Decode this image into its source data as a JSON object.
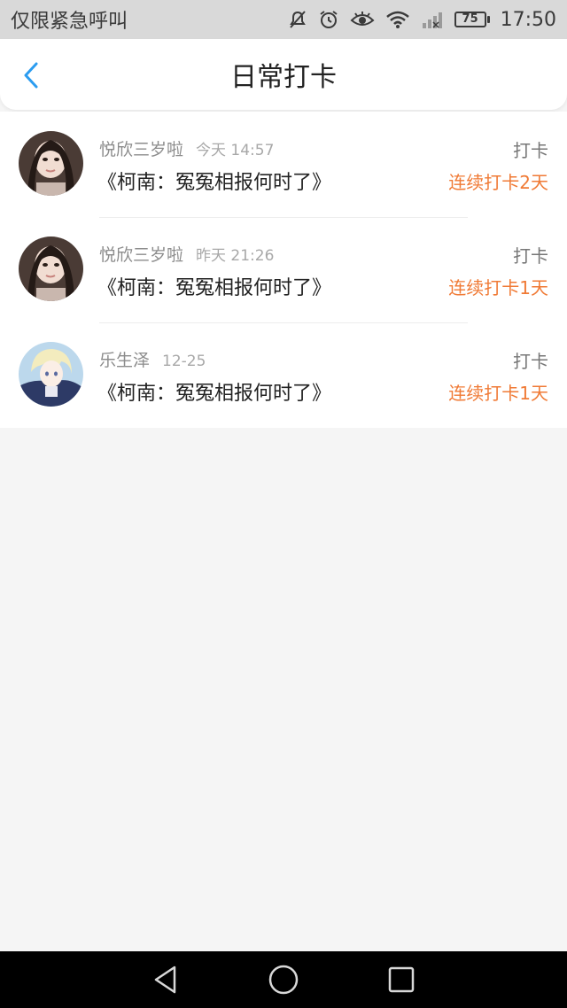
{
  "status_bar": {
    "carrier": "仅限紧急呼叫",
    "battery": "75",
    "time": "17:50",
    "icons": [
      "mute-icon",
      "alarm-icon",
      "eye-icon",
      "wifi-icon",
      "signal-icon"
    ]
  },
  "header": {
    "title": "日常打卡",
    "back_icon": "back-chevron-icon",
    "accent_color": "#2b9cf0"
  },
  "records": [
    {
      "name": "悦欣三岁啦",
      "time": "今天 14:57",
      "book": "《柯南：冤冤相报何时了》",
      "action": "打卡",
      "streak": "连续打卡2天"
    },
    {
      "name": "悦欣三岁啦",
      "time": "昨天 21:26",
      "book": "《柯南：冤冤相报何时了》",
      "action": "打卡",
      "streak": "连续打卡1天"
    },
    {
      "name": "乐生泽",
      "time": "12-25",
      "book": "《柯南：冤冤相报何时了》",
      "action": "打卡",
      "streak": "连续打卡1天"
    }
  ],
  "colors": {
    "streak": "#f07a35",
    "name": "#8c8c8c",
    "background": "#f5f5f5"
  },
  "system_nav": {
    "icons": [
      "back-triangle-icon",
      "home-circle-icon",
      "recents-square-icon"
    ]
  }
}
